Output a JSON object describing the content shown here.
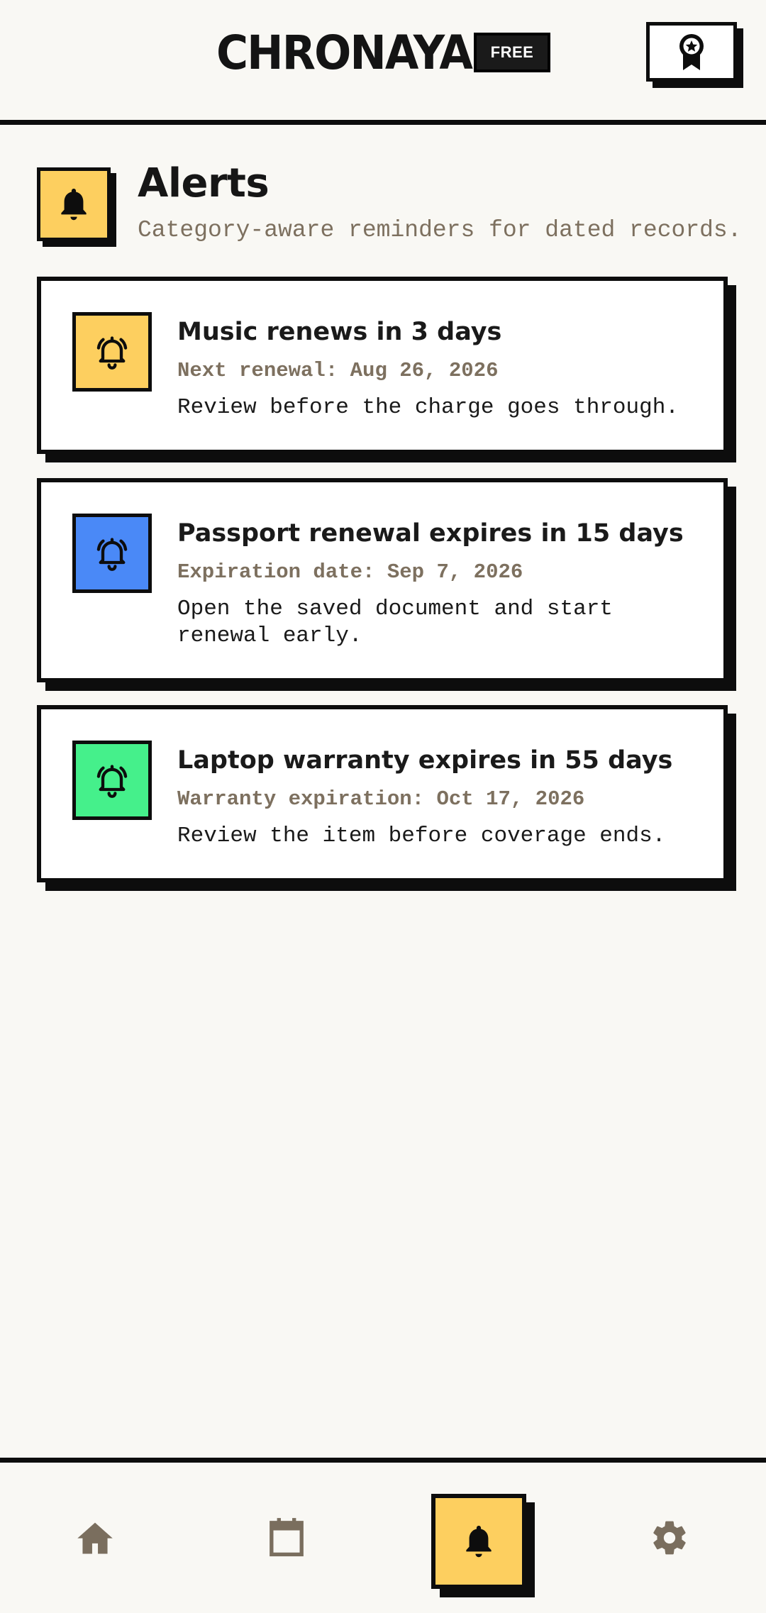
{
  "header": {
    "brand": "CHRONAYA",
    "plan_badge": "FREE",
    "award_icon": "award-ribbon-icon"
  },
  "section": {
    "icon": "bell-icon",
    "title": "Alerts",
    "subtitle": "Category-aware reminders for dated records."
  },
  "alerts": [
    {
      "title": "Music renews in 3 days",
      "meta": "Next renewal: Aug 26, 2026",
      "body": "Review before the charge goes through.",
      "icon": "bell-ringing-icon",
      "color": "#fdcf5f"
    },
    {
      "title": "Passport renewal expires in 15 days",
      "meta": "Expiration date: Sep 7, 2026",
      "body": "Open the saved document and start renewal early.",
      "icon": "bell-ringing-icon",
      "color": "#4a89f7"
    },
    {
      "title": "Laptop warranty expires in 55 days",
      "meta": "Warranty expiration: Oct 17, 2026",
      "body": "Review the item before coverage ends.",
      "icon": "bell-ringing-icon",
      "color": "#45f08b"
    }
  ],
  "nav": {
    "items": [
      {
        "icon": "home-icon",
        "active": false
      },
      {
        "icon": "calendar-icon",
        "active": false
      },
      {
        "icon": "bell-icon",
        "active": true
      },
      {
        "icon": "gear-icon",
        "active": false
      }
    ],
    "inactive_color": "#7a6e5e",
    "active_color": "#fdcf5f"
  },
  "colors": {
    "background": "#f9f8f4",
    "ink": "#0d0d0d",
    "muted": "#7d705f",
    "accent": "#fdcf5f"
  }
}
